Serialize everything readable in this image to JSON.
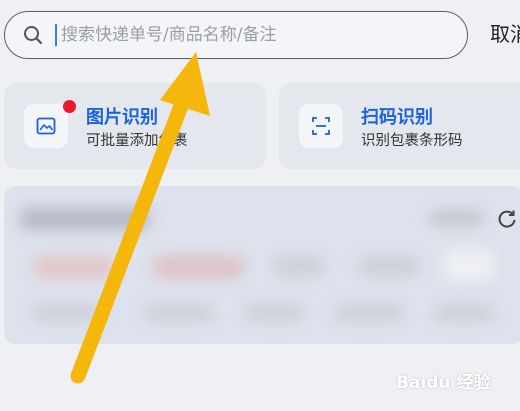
{
  "search": {
    "placeholder": "搜索快递单号/商品名称/备注",
    "value": "",
    "cancel_label": "取消"
  },
  "cards": [
    {
      "title": "图片识别",
      "subtitle": "可批量添加包裹",
      "icon": "image-icon",
      "badge": "red-dot"
    },
    {
      "title": "扫码识别",
      "subtitle": "识别包裹条形码",
      "icon": "scan-icon"
    }
  ],
  "watermark": "Baidu 经验",
  "colors": {
    "accent": "#1a63e0",
    "badge": "#e8182e",
    "annotation_arrow": "#f5b70c"
  }
}
